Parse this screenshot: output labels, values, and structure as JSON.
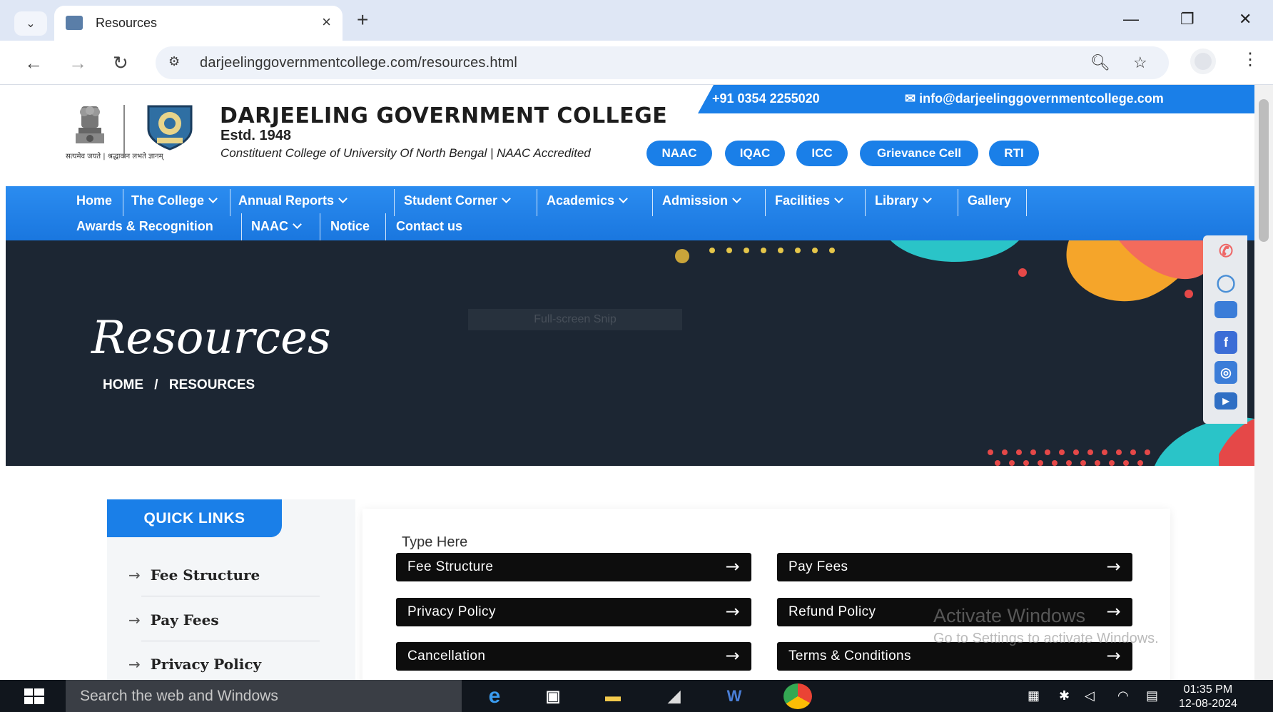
{
  "browser": {
    "tab_title": "Resources",
    "url": "darjeelinggovernmentcollege.com/resources.html",
    "new_tab": "+",
    "close_tab": "×"
  },
  "header": {
    "emblem_motto": "सत्यमेव जयते | श्रद्धावान लभते ज्ञानम्",
    "college_name": "DARJEELING GOVERNMENT COLLEGE",
    "estd": "Estd. 1948",
    "subline": "Constituent College of University Of North Bengal | NAAC Accredited",
    "phone": "+91 0354 2255020",
    "email": "info@darjeelinggovernmentcollege.com",
    "pills": [
      "NAAC",
      "IQAC",
      "ICC",
      "Grievance Cell",
      "RTI"
    ]
  },
  "nav": {
    "row1": [
      {
        "label": "Home",
        "dropdown": false
      },
      {
        "label": "The College",
        "dropdown": true
      },
      {
        "label": "Annual Reports",
        "dropdown": true
      },
      {
        "label": "Student Corner",
        "dropdown": true
      },
      {
        "label": "Academics",
        "dropdown": true
      },
      {
        "label": "Admission",
        "dropdown": true
      },
      {
        "label": "Facilities",
        "dropdown": true
      },
      {
        "label": "Library",
        "dropdown": true
      },
      {
        "label": "Gallery",
        "dropdown": false
      }
    ],
    "row2": [
      {
        "label": "Awards & Recognition",
        "dropdown": false
      },
      {
        "label": "NAAC",
        "dropdown": true
      },
      {
        "label": "Notice",
        "dropdown": false
      },
      {
        "label": "Contact us",
        "dropdown": false
      }
    ]
  },
  "banner": {
    "title": "Resources",
    "breadcrumb_home": "HOME",
    "breadcrumb_sep": "/",
    "breadcrumb_current": "RESOURCES",
    "ghost_text": "Full-screen Snip"
  },
  "quick_links": {
    "heading": "QUICK LINKS",
    "items": [
      "Fee Structure",
      "Pay Fees",
      "Privacy Policy"
    ]
  },
  "resources": {
    "type_here": "Type Here",
    "buttons": [
      "Fee Structure",
      "Pay Fees",
      "Privacy Policy",
      "Refund Policy",
      "Cancellation",
      "Terms & Conditions"
    ]
  },
  "watermark": {
    "line1": "Activate Windows",
    "line2": "Go to Settings to activate Windows."
  },
  "taskbar": {
    "search_placeholder": "Search the web and Windows",
    "time": "01:35 PM",
    "date": "12-08-2024"
  },
  "colors": {
    "accent": "#1a7fe8",
    "banner_bg": "#1c2633",
    "button_bg": "#0d0d0d"
  }
}
